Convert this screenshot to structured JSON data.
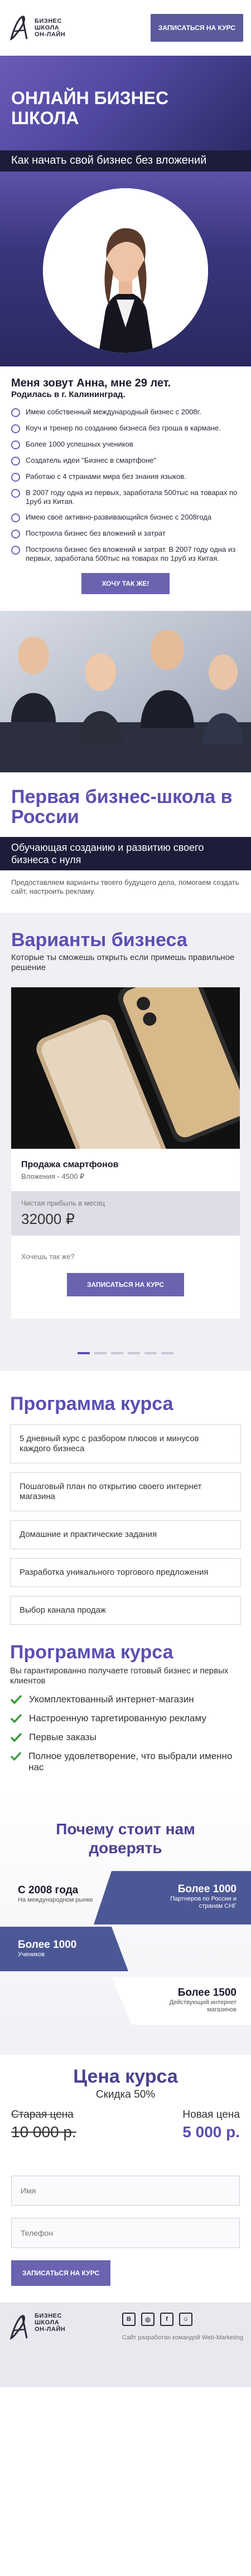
{
  "header": {
    "logo_line1": "БИЗНЕС",
    "logo_line2": "ШКОЛА",
    "logo_line3": "ОН-ЛАЙН",
    "cta": "Записаться на курс"
  },
  "hero": {
    "title": "Онлайн бизнес школа",
    "subtitle": "Как начать свой бизнес без вложений"
  },
  "about": {
    "title": "Меня зовут Анна, мне 29 лет.",
    "subtitle": "Родилась в г. Калининград.",
    "items": [
      "Имею собственный международный бизнес с 2008г.",
      "Коуч и тренер по созданию бизнеса без грошa в кармане.",
      "Более 1000 успешных учеников",
      "Создатель идеи \"Бизнес в смартфоне\"",
      "Работаю с 4 странами мира без знания языков.",
      "В 2007 году одна из первых, заработала 500тыс на товарах по 1руб из Китая.",
      "Имею своё активно-развивающийся бизнес с 2008года",
      "Построила бизнес без вложений и затрат",
      "Построила бизнес без вложений и затрат. В 2007 году одна из первых, заработала 500тыс на товарах по 1руб из Китая."
    ],
    "cta": "Хочу так же!"
  },
  "first_school": {
    "title": "Первая бизнес-школа в России",
    "band": "Обучающая созданию и развитию своего бизнеса с нуля",
    "text": "Предоставляем варианты твоего будущего дела, помогаем создать сайт, настроить рекламу."
  },
  "variants": {
    "title": "Варианты бизнеса",
    "subtitle": "Которые ты сможешь открыть если примешь правильное решение",
    "card_title": "Продажа смартфонов",
    "card_price": "Вложения - 4500 ₽",
    "profit_label": "Чистая прибыль в месяц",
    "profit_value": "32000 ₽",
    "want": "Хочешь так же?",
    "cta": "Записаться на курс",
    "slides": 6,
    "active_slide": 1
  },
  "program": {
    "title": "Программа курса",
    "items": [
      "5 дневный курс с разбором плюсов и минусов каждого бизнеса",
      "Пошаговый план по открытию своего интернет магазина",
      "Домашние и практические задания",
      "Разработка уникального торгового предложения",
      "Выбор канала продаж"
    ],
    "title2": "Программа курса",
    "subtitle2": "Вы гарантированно получаете готовый бизнес и первых клиентов",
    "checks": [
      "Укомплектованный интернет-магазин",
      "Настроенную таргетированную рекламу",
      "Первые заказы",
      "Полное удовлетворение, что выбрали именно нас"
    ]
  },
  "why": {
    "title": "Почему стоит нам доверять",
    "stats": [
      {
        "num": "С 2008 года",
        "cap": "На международном рынке"
      },
      {
        "num": "Более 1000",
        "cap": "Партнеров по России и странам СНГ"
      },
      {
        "num": "Более 1000",
        "cap": "Учеников"
      },
      {
        "num": "Более 1500",
        "cap": "Действующий интернет магазинов"
      }
    ]
  },
  "price": {
    "title": "Цена курса",
    "discount": "Скидка 50%",
    "old_label": "Старая цена",
    "old_value": "10 000 р.",
    "new_label": "Новая цена",
    "new_value": "5 000 р."
  },
  "form": {
    "name_placeholder": "Имя",
    "phone_placeholder": "Телефон",
    "cta": "Записаться на курс"
  },
  "footer": {
    "logo_line1": "БИЗНЕС",
    "logo_line2": "ШКОЛА",
    "logo_line3": "ОН-ЛАЙН",
    "credit": "Сайт разработан командой Web-Marketing",
    "social_icons": [
      "vk-icon",
      "instagram-icon",
      "facebook-icon",
      "ok-icon"
    ]
  },
  "colors": {
    "accent": "#5b4fb0",
    "dark": "#1d1d3a",
    "button": "#6a63b0"
  }
}
